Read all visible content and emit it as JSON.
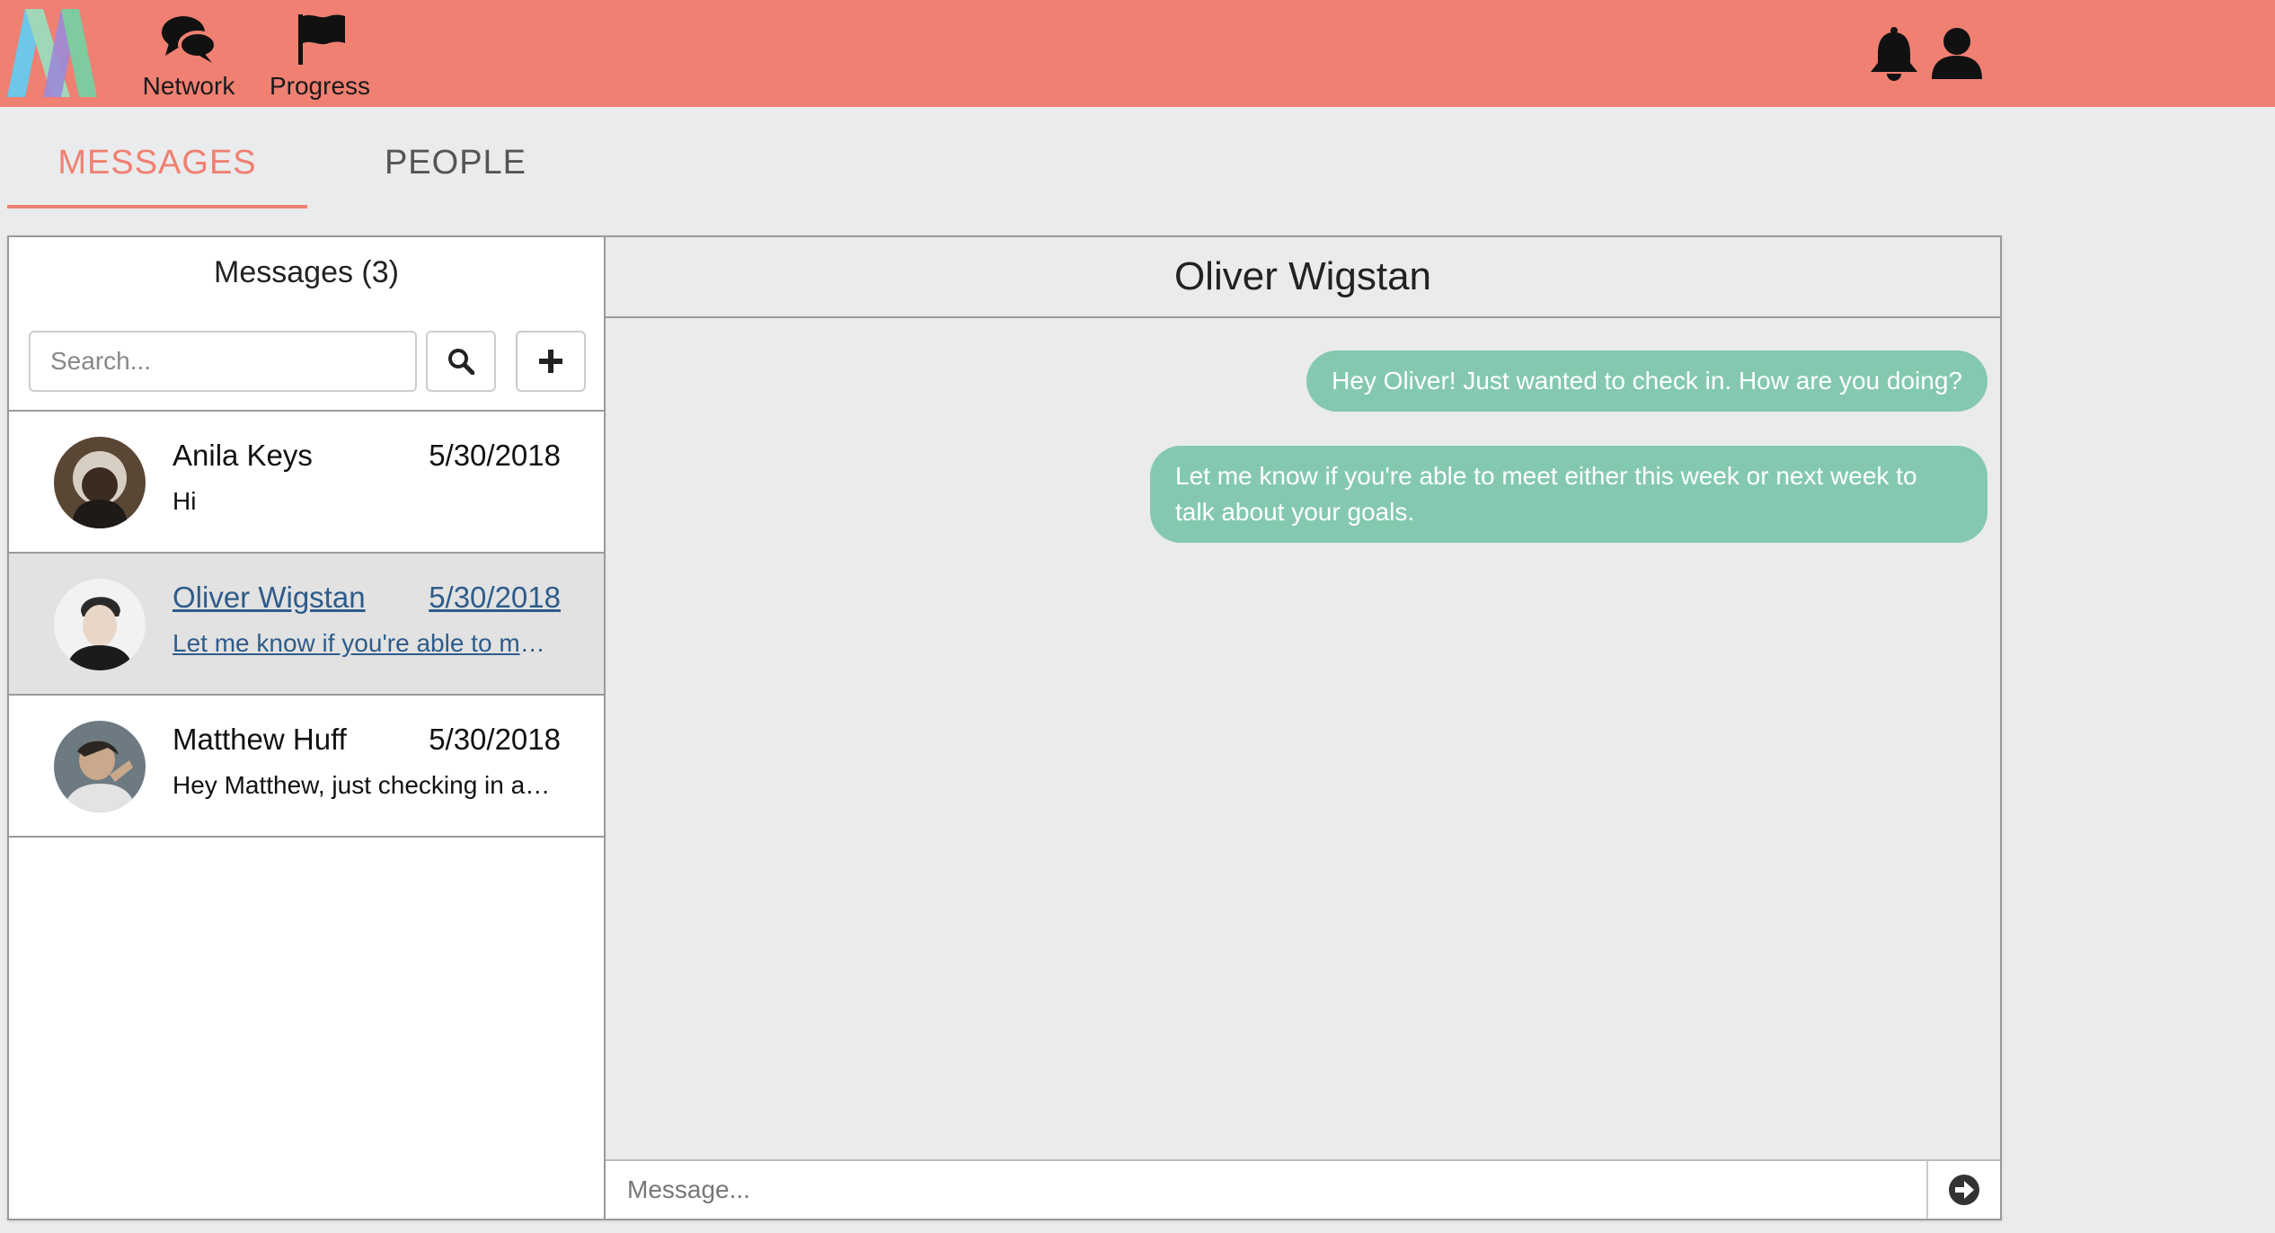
{
  "colors": {
    "topbar": "#F08072",
    "accent": "#F08072",
    "bubble": "#84C9AF",
    "link": "#2E5C8A",
    "page_bg": "#EAEBED"
  },
  "nav": {
    "items": [
      {
        "label": "Network",
        "icon": "chat-bubbles-icon"
      },
      {
        "label": "Progress",
        "icon": "flag-icon"
      }
    ],
    "right_icons": [
      "bell-icon",
      "user-icon"
    ]
  },
  "tabs": [
    {
      "label": "MESSAGES",
      "active": true
    },
    {
      "label": "PEOPLE",
      "active": false
    }
  ],
  "sidebar": {
    "title": "Messages (3)",
    "search_placeholder": "Search...",
    "conversations": [
      {
        "name": "Anila Keys",
        "date": "5/30/2018",
        "preview": "Hi",
        "active": false
      },
      {
        "name": "Oliver Wigstan",
        "date": "5/30/2018",
        "preview": "Let me know if you're able to meet either this week or next week to talk about your goals.",
        "active": true
      },
      {
        "name": "Matthew Huff",
        "date": "5/30/2018",
        "preview": "Hey Matthew, just checking in and seeing how things are going.",
        "active": false
      }
    ]
  },
  "chat": {
    "contact_name": "Oliver Wigstan",
    "messages": [
      {
        "text": "Hey Oliver! Just wanted to check in. How are you doing?",
        "from": "me"
      },
      {
        "text": "Let me know if you're able to meet either this week or next week to talk about your goals.",
        "from": "me"
      }
    ],
    "input_placeholder": "Message..."
  }
}
